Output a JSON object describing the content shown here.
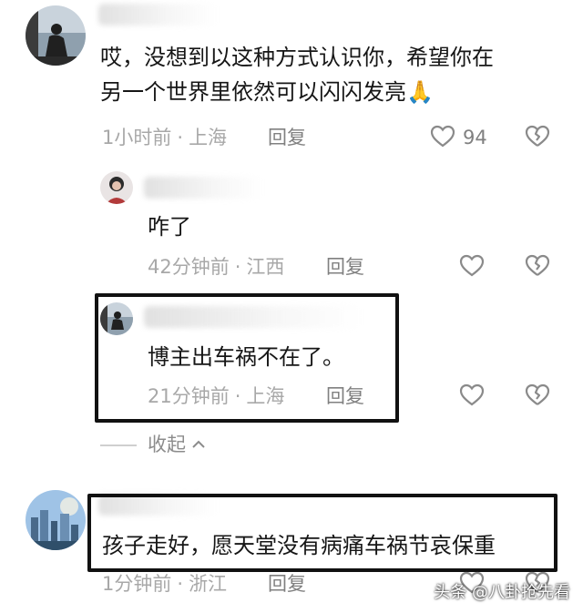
{
  "comments": [
    {
      "text_line1": "哎，没想到以这种方式认识你，希望你在",
      "text_line2": "另一个世界里依然可以闪闪发亮",
      "emoji": "🙏",
      "time": "1小时前",
      "location": "上海",
      "reply_label": "回复",
      "likes": "94"
    },
    {
      "text": "咋了",
      "time": "42分钟前",
      "location": "江西",
      "reply_label": "回复"
    },
    {
      "text": "博主出车祸不在了。",
      "time": "21分钟前",
      "location": "上海",
      "reply_label": "回复"
    },
    {
      "text": "孩子走好，愿天堂没有病痛车祸节哀保重",
      "time": "1分钟前",
      "location": "浙江",
      "reply_label": "回复"
    }
  ],
  "collapse_label": "收起",
  "separator": "·",
  "watermark": "头条 @八卦抢先看",
  "colors": {
    "highlight_border": "#111111",
    "meta_text": "#a8a8a8",
    "body_text": "#161616"
  },
  "icons": [
    "heart-icon",
    "broken-heart-icon",
    "chevron-up-icon",
    "praying-hands-emoji"
  ]
}
